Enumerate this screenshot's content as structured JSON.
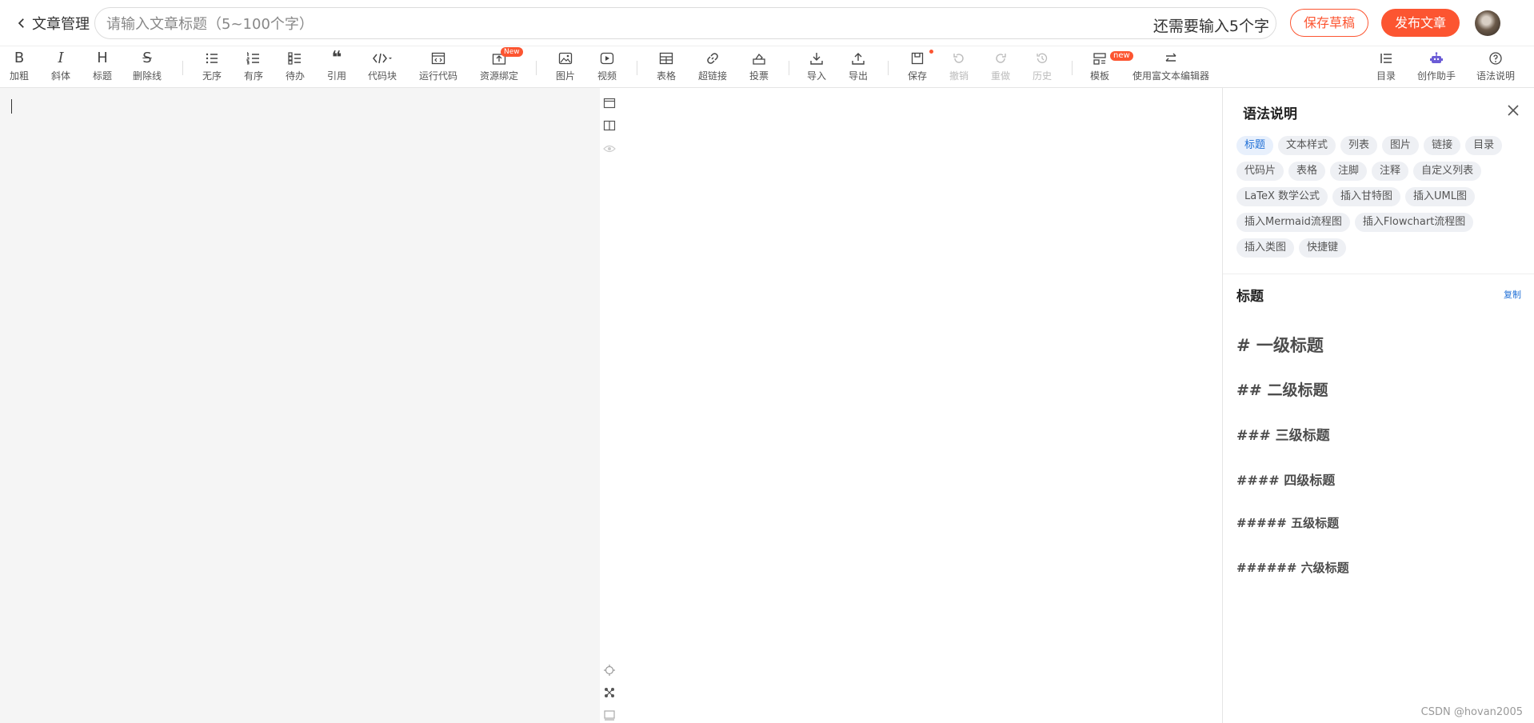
{
  "header": {
    "back_label": "文章管理",
    "title_placeholder": "请输入文章标题（5~100个字）",
    "title_value": "",
    "title_hint": "还需要输入5个字",
    "save_draft_label": "保存草稿",
    "publish_label": "发布文章"
  },
  "toolbar": {
    "bold": "加粗",
    "italic": "斜体",
    "heading": "标题",
    "strike": "删除线",
    "unordered": "无序",
    "ordered": "有序",
    "todo": "待办",
    "quote": "引用",
    "code_block": "代码块",
    "run_code": "运行代码",
    "resource": "资源绑定",
    "resource_badge": "New",
    "image": "图片",
    "video": "视频",
    "table": "表格",
    "link": "超链接",
    "vote": "投票",
    "import": "导入",
    "export": "导出",
    "save": "保存",
    "undo": "撤销",
    "redo": "重做",
    "history": "历史",
    "template": "模板",
    "template_badge": "new",
    "rich_editor": "使用富文本编辑器",
    "toc": "目录",
    "assistant": "创作助手",
    "syntax_help": "语法说明"
  },
  "panel": {
    "title": "语法说明",
    "tags": [
      "标题",
      "文本样式",
      "列表",
      "图片",
      "链接",
      "目录",
      "代码片",
      "表格",
      "注脚",
      "注释",
      "自定义列表",
      "LaTeX 数学公式",
      "插入甘特图",
      "插入UML图",
      "插入Mermaid流程图",
      "插入Flowchart流程图",
      "插入类图",
      "快捷键"
    ],
    "active_tag": "标题",
    "section_title": "标题",
    "copy_label": "复制",
    "headings": [
      "# 一级标题",
      "## 二级标题",
      "### 三级标题",
      "#### 四级标题",
      "##### 五级标题",
      "###### 六级标题"
    ]
  },
  "watermark": "CSDN @hovan2005"
}
